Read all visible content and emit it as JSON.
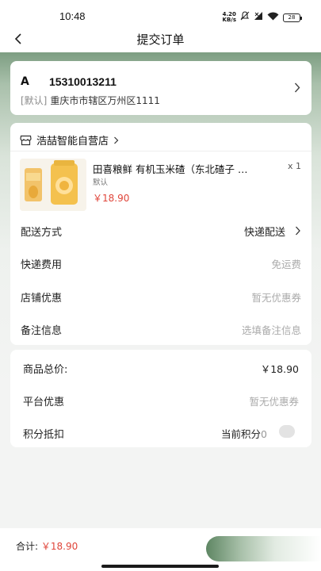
{
  "status_bar": {
    "time": "10:48",
    "net_speed_value": "4.20",
    "net_speed_unit": "KB/s",
    "battery": "28"
  },
  "nav": {
    "title": "提交订单"
  },
  "address": {
    "name": "A",
    "phone": "15310013211",
    "default_tag": "[默认]",
    "detail": "重庆市市辖区万州区1111"
  },
  "shop": {
    "name": "浩喆智能自营店"
  },
  "product": {
    "title": "田喜粮鲜 有机玉米碴（东北碴子 …",
    "qty": "x 1",
    "spec": "默认",
    "price": "￥18.90"
  },
  "delivery": {
    "method_label": "配送方式",
    "method_value": "快递配送",
    "fee_label": "快递费用",
    "fee_value": "免运费",
    "store_coupon_label": "店铺优惠",
    "store_coupon_value": "暂无优惠券",
    "remark_label": "备注信息",
    "remark_placeholder": "选填备注信息"
  },
  "summary": {
    "goods_total_label": "商品总价:",
    "goods_total_value": "￥18.90",
    "platform_coupon_label": "平台优惠",
    "platform_coupon_value": "暂无优惠券",
    "points_label": "积分抵扣",
    "points_current_label": "当前积分",
    "points_current_value": "0"
  },
  "footer": {
    "total_label": "合计:",
    "total_value": "￥18.90"
  },
  "colors": {
    "accent_green": "#7d9e82",
    "price_red": "#e0463b"
  }
}
